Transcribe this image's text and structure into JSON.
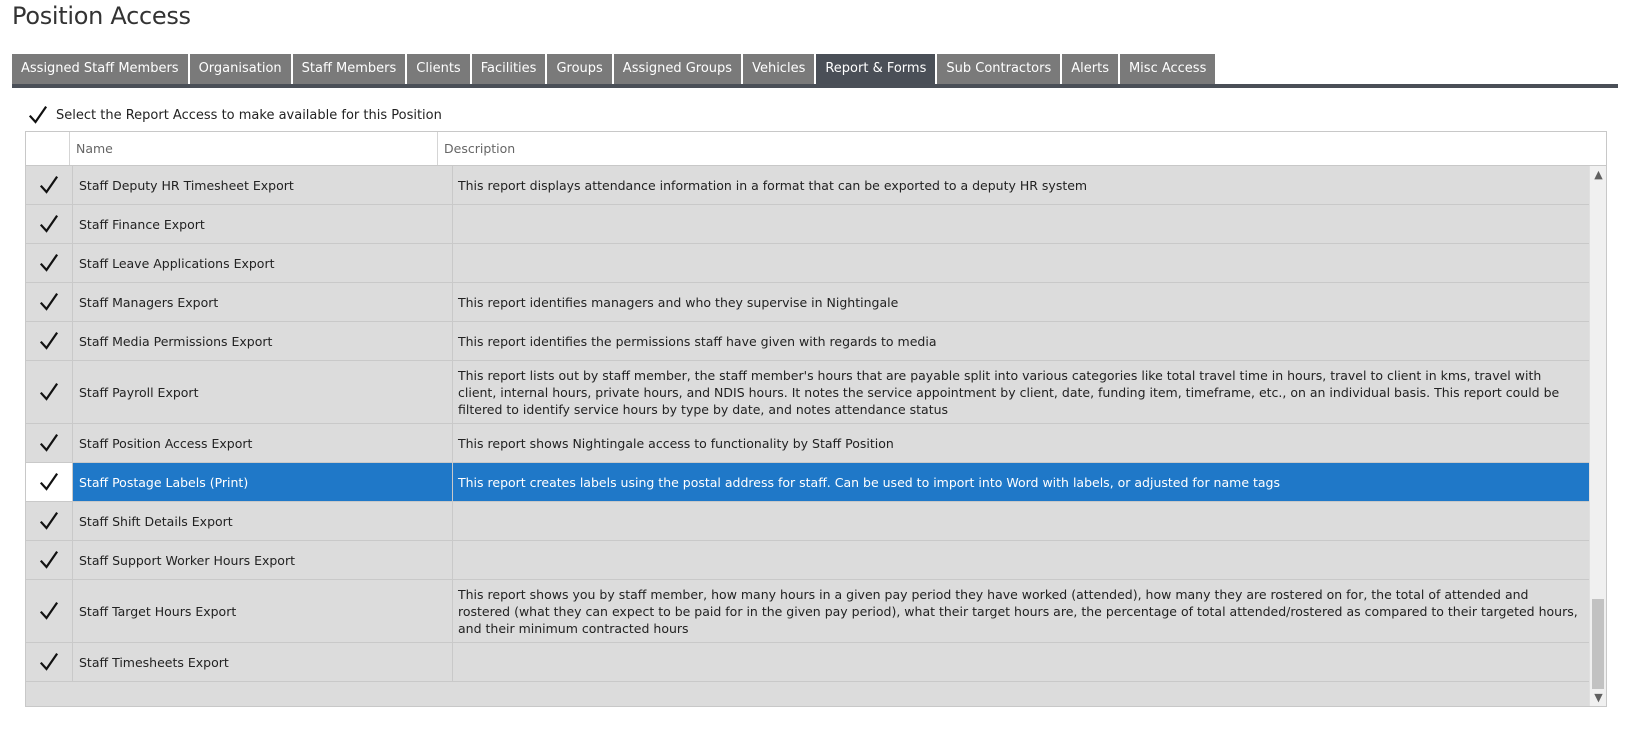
{
  "page": {
    "title": "Position Access"
  },
  "tabs": [
    {
      "label": "Assigned Staff Members",
      "active": false
    },
    {
      "label": "Organisation",
      "active": false
    },
    {
      "label": "Staff Members",
      "active": false
    },
    {
      "label": "Clients",
      "active": false
    },
    {
      "label": "Facilities",
      "active": false
    },
    {
      "label": "Groups",
      "active": false
    },
    {
      "label": "Assigned Groups",
      "active": false
    },
    {
      "label": "Vehicles",
      "active": false
    },
    {
      "label": "Report & Forms",
      "active": true
    },
    {
      "label": "Sub Contractors",
      "active": false
    },
    {
      "label": "Alerts",
      "active": false
    },
    {
      "label": "Misc Access",
      "active": false
    }
  ],
  "select_all": {
    "label": "Select the Report Access to make available for this Position",
    "checked": true
  },
  "grid": {
    "columns": {
      "name": "Name",
      "description": "Description"
    },
    "rows": [
      {
        "name": "Staff Deputy HR Timesheet Export",
        "description": "This report displays attendance information in a format that can be exported to a deputy HR system",
        "checked": true,
        "selected": false
      },
      {
        "name": "Staff Finance Export",
        "description": "",
        "checked": true,
        "selected": false
      },
      {
        "name": "Staff Leave Applications Export",
        "description": "",
        "checked": true,
        "selected": false
      },
      {
        "name": "Staff Managers Export",
        "description": "This report identifies managers and who they supervise in Nightingale",
        "checked": true,
        "selected": false
      },
      {
        "name": "Staff Media Permissions Export",
        "description": "This report identifies the permissions staff have given with regards to media",
        "checked": true,
        "selected": false
      },
      {
        "name": "Staff Payroll Export",
        "description": "This report lists out by staff member, the staff member's hours that are payable split into various categories like total travel time in hours, travel to client in kms, travel with client, internal hours, private hours, and NDIS hours.  It notes the service appointment by client, date, funding item, timeframe, etc., on an individual basis.  This report could be filtered to identify service hours by type by date, and notes attendance status",
        "checked": true,
        "selected": false
      },
      {
        "name": "Staff Position Access Export",
        "description": "This report shows Nightingale access to functionality by Staff Position",
        "checked": true,
        "selected": false
      },
      {
        "name": "Staff Postage Labels (Print)",
        "description": "This report creates labels using the postal address for staff.  Can be used to import into Word with labels, or adjusted for name tags",
        "checked": true,
        "selected": true
      },
      {
        "name": "Staff Shift Details Export",
        "description": "",
        "checked": true,
        "selected": false
      },
      {
        "name": "Staff Support Worker Hours Export",
        "description": "",
        "checked": true,
        "selected": false
      },
      {
        "name": "Staff Target Hours Export",
        "description": "This report shows you by staff member, how many hours in a given pay period they have worked (attended), how many they are rostered on for, the total of attended and rostered (what they can expect to be paid for in the given pay period), what their target hours are, the percentage of total attended/rostered as compared to their targeted hours, and their minimum contracted hours",
        "checked": true,
        "selected": false
      },
      {
        "name": "Staff Timesheets Export",
        "description": "",
        "checked": true,
        "selected": false
      }
    ]
  },
  "scrollbar": {
    "up_icon": "chevron-up-icon",
    "down_icon": "chevron-down-icon",
    "position": 1.0
  }
}
